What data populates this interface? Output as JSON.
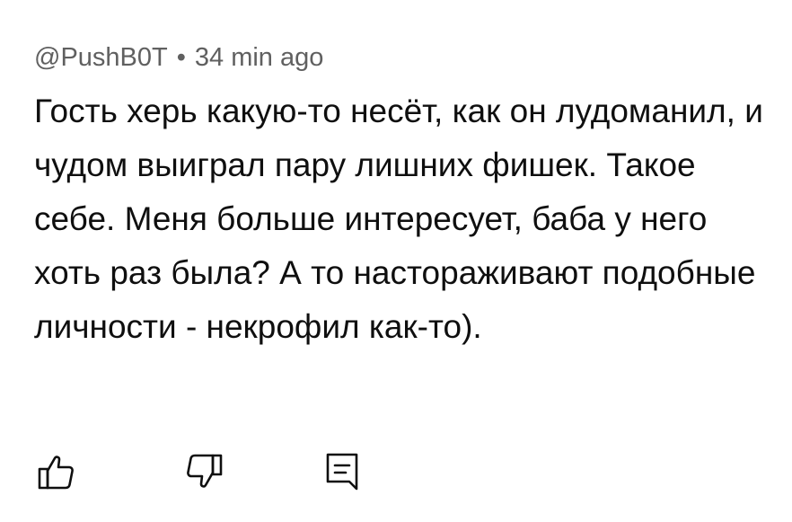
{
  "comment": {
    "author": "@PushB0T",
    "separator": "•",
    "time": "34 min ago",
    "text": "Гость херь какую-то несёт, как он лудоманил, и чудом выиграл пару лишних фишек. Такое себе. Меня больше интересует, баба у него хоть раз была? А то настораживают подобные личности - некрофил как-то)."
  },
  "actions": {
    "like_icon": "thumbs-up-outline",
    "dislike_icon": "thumbs-down-outline",
    "reply_icon": "comment-reply"
  },
  "colors": {
    "text": "#0f0f0f",
    "meta": "#606060",
    "icon": "#0f0f0f",
    "background": "#ffffff"
  }
}
